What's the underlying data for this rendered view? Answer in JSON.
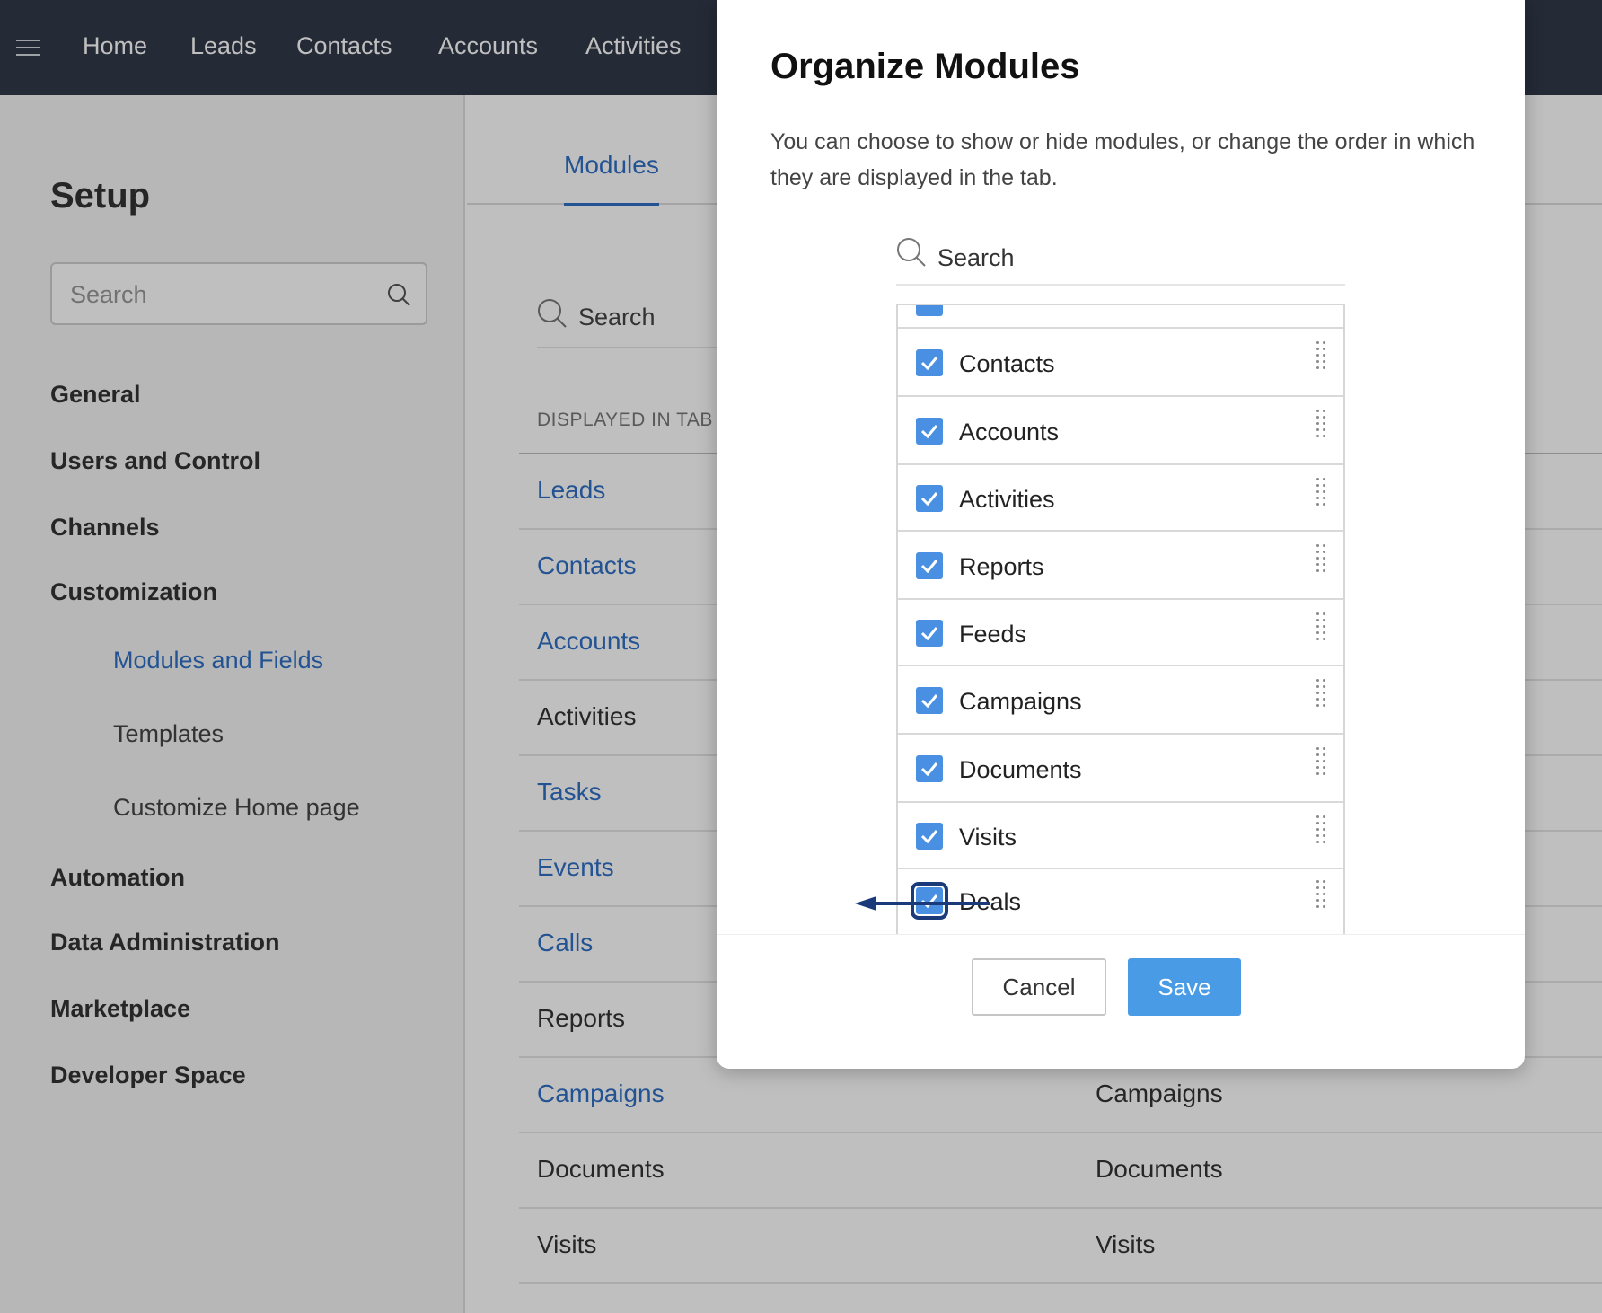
{
  "topnav": {
    "items": [
      "Home",
      "Leads",
      "Contacts",
      "Accounts",
      "Activities"
    ]
  },
  "sidebar": {
    "title": "Setup",
    "search_placeholder": "Search",
    "items": [
      {
        "label": "General"
      },
      {
        "label": "Users and Control"
      },
      {
        "label": "Channels"
      },
      {
        "label": "Customization"
      },
      {
        "label": "Modules and Fields"
      },
      {
        "label": "Templates"
      },
      {
        "label": "Customize Home page"
      },
      {
        "label": "Automation"
      },
      {
        "label": "Data Administration"
      },
      {
        "label": "Marketplace"
      },
      {
        "label": "Developer Space"
      }
    ]
  },
  "main": {
    "tab": "Modules",
    "search_placeholder": "Search",
    "column_header": "DISPLAYED IN TAB",
    "rows": [
      {
        "name": "Leads",
        "label": ""
      },
      {
        "name": "Contacts",
        "label": ""
      },
      {
        "name": "Accounts",
        "label": ""
      },
      {
        "name": "Activities",
        "label": ""
      },
      {
        "name": "Tasks",
        "label": ""
      },
      {
        "name": "Events",
        "label": ""
      },
      {
        "name": "Calls",
        "label": ""
      },
      {
        "name": "Reports",
        "label": ""
      },
      {
        "name": "Campaigns",
        "label": "Campaigns"
      },
      {
        "name": "Documents",
        "label": "Documents"
      },
      {
        "name": "Visits",
        "label": "Visits"
      }
    ]
  },
  "dialog": {
    "title": "Organize Modules",
    "description": "You can choose to show or hide modules, or change the order in which they are displayed in the tab.",
    "search_placeholder": "Search",
    "modules": [
      {
        "label": "Contacts",
        "checked": true
      },
      {
        "label": "Accounts",
        "checked": true
      },
      {
        "label": "Activities",
        "checked": true
      },
      {
        "label": "Reports",
        "checked": true
      },
      {
        "label": "Feeds",
        "checked": true
      },
      {
        "label": "Campaigns",
        "checked": true
      },
      {
        "label": "Documents",
        "checked": true
      },
      {
        "label": "Visits",
        "checked": true
      },
      {
        "label": "Deals",
        "checked": true
      }
    ],
    "cancel_label": "Cancel",
    "save_label": "Save"
  },
  "colors": {
    "nav_bg": "#313949",
    "link_blue": "#2f6fc4",
    "checkbox_blue": "#4a90e2",
    "save_blue": "#4a9be6",
    "arrow_navy": "#1a3a7a"
  }
}
